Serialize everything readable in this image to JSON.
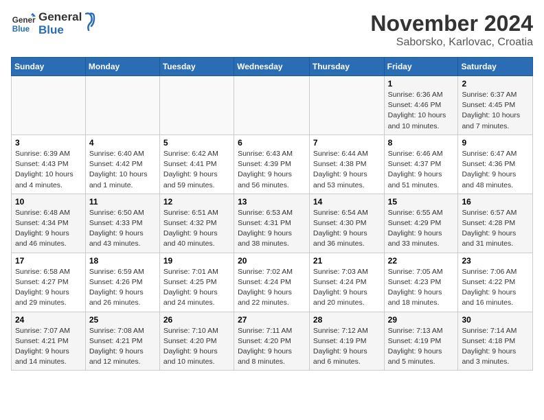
{
  "logo": {
    "line1": "General",
    "line2": "Blue"
  },
  "title": "November 2024",
  "location": "Saborsko, Karlovac, Croatia",
  "weekdays": [
    "Sunday",
    "Monday",
    "Tuesday",
    "Wednesday",
    "Thursday",
    "Friday",
    "Saturday"
  ],
  "weeks": [
    [
      {
        "day": "",
        "info": ""
      },
      {
        "day": "",
        "info": ""
      },
      {
        "day": "",
        "info": ""
      },
      {
        "day": "",
        "info": ""
      },
      {
        "day": "",
        "info": ""
      },
      {
        "day": "1",
        "info": "Sunrise: 6:36 AM\nSunset: 4:46 PM\nDaylight: 10 hours\nand 10 minutes."
      },
      {
        "day": "2",
        "info": "Sunrise: 6:37 AM\nSunset: 4:45 PM\nDaylight: 10 hours\nand 7 minutes."
      }
    ],
    [
      {
        "day": "3",
        "info": "Sunrise: 6:39 AM\nSunset: 4:43 PM\nDaylight: 10 hours\nand 4 minutes."
      },
      {
        "day": "4",
        "info": "Sunrise: 6:40 AM\nSunset: 4:42 PM\nDaylight: 10 hours\nand 1 minute."
      },
      {
        "day": "5",
        "info": "Sunrise: 6:42 AM\nSunset: 4:41 PM\nDaylight: 9 hours\nand 59 minutes."
      },
      {
        "day": "6",
        "info": "Sunrise: 6:43 AM\nSunset: 4:39 PM\nDaylight: 9 hours\nand 56 minutes."
      },
      {
        "day": "7",
        "info": "Sunrise: 6:44 AM\nSunset: 4:38 PM\nDaylight: 9 hours\nand 53 minutes."
      },
      {
        "day": "8",
        "info": "Sunrise: 6:46 AM\nSunset: 4:37 PM\nDaylight: 9 hours\nand 51 minutes."
      },
      {
        "day": "9",
        "info": "Sunrise: 6:47 AM\nSunset: 4:36 PM\nDaylight: 9 hours\nand 48 minutes."
      }
    ],
    [
      {
        "day": "10",
        "info": "Sunrise: 6:48 AM\nSunset: 4:34 PM\nDaylight: 9 hours\nand 46 minutes."
      },
      {
        "day": "11",
        "info": "Sunrise: 6:50 AM\nSunset: 4:33 PM\nDaylight: 9 hours\nand 43 minutes."
      },
      {
        "day": "12",
        "info": "Sunrise: 6:51 AM\nSunset: 4:32 PM\nDaylight: 9 hours\nand 40 minutes."
      },
      {
        "day": "13",
        "info": "Sunrise: 6:53 AM\nSunset: 4:31 PM\nDaylight: 9 hours\nand 38 minutes."
      },
      {
        "day": "14",
        "info": "Sunrise: 6:54 AM\nSunset: 4:30 PM\nDaylight: 9 hours\nand 36 minutes."
      },
      {
        "day": "15",
        "info": "Sunrise: 6:55 AM\nSunset: 4:29 PM\nDaylight: 9 hours\nand 33 minutes."
      },
      {
        "day": "16",
        "info": "Sunrise: 6:57 AM\nSunset: 4:28 PM\nDaylight: 9 hours\nand 31 minutes."
      }
    ],
    [
      {
        "day": "17",
        "info": "Sunrise: 6:58 AM\nSunset: 4:27 PM\nDaylight: 9 hours\nand 29 minutes."
      },
      {
        "day": "18",
        "info": "Sunrise: 6:59 AM\nSunset: 4:26 PM\nDaylight: 9 hours\nand 26 minutes."
      },
      {
        "day": "19",
        "info": "Sunrise: 7:01 AM\nSunset: 4:25 PM\nDaylight: 9 hours\nand 24 minutes."
      },
      {
        "day": "20",
        "info": "Sunrise: 7:02 AM\nSunset: 4:24 PM\nDaylight: 9 hours\nand 22 minutes."
      },
      {
        "day": "21",
        "info": "Sunrise: 7:03 AM\nSunset: 4:24 PM\nDaylight: 9 hours\nand 20 minutes."
      },
      {
        "day": "22",
        "info": "Sunrise: 7:05 AM\nSunset: 4:23 PM\nDaylight: 9 hours\nand 18 minutes."
      },
      {
        "day": "23",
        "info": "Sunrise: 7:06 AM\nSunset: 4:22 PM\nDaylight: 9 hours\nand 16 minutes."
      }
    ],
    [
      {
        "day": "24",
        "info": "Sunrise: 7:07 AM\nSunset: 4:21 PM\nDaylight: 9 hours\nand 14 minutes."
      },
      {
        "day": "25",
        "info": "Sunrise: 7:08 AM\nSunset: 4:21 PM\nDaylight: 9 hours\nand 12 minutes."
      },
      {
        "day": "26",
        "info": "Sunrise: 7:10 AM\nSunset: 4:20 PM\nDaylight: 9 hours\nand 10 minutes."
      },
      {
        "day": "27",
        "info": "Sunrise: 7:11 AM\nSunset: 4:20 PM\nDaylight: 9 hours\nand 8 minutes."
      },
      {
        "day": "28",
        "info": "Sunrise: 7:12 AM\nSunset: 4:19 PM\nDaylight: 9 hours\nand 6 minutes."
      },
      {
        "day": "29",
        "info": "Sunrise: 7:13 AM\nSunset: 4:19 PM\nDaylight: 9 hours\nand 5 minutes."
      },
      {
        "day": "30",
        "info": "Sunrise: 7:14 AM\nSunset: 4:18 PM\nDaylight: 9 hours\nand 3 minutes."
      }
    ]
  ]
}
